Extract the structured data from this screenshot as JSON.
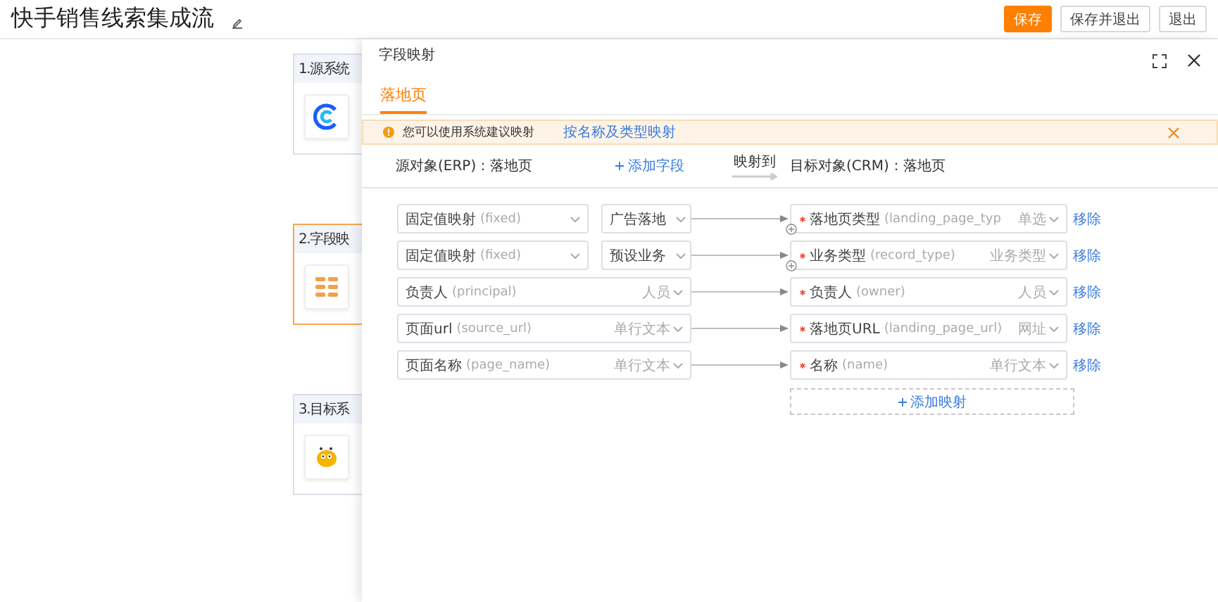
{
  "page_title": "快手销售线索集成流",
  "header_buttons": [
    {
      "label": "保存",
      "kind": "primary"
    },
    {
      "label": "保存并退出",
      "kind": "default"
    },
    {
      "label": "退出",
      "kind": "default"
    }
  ],
  "steps": [
    {
      "label": "1.源系统",
      "selected": false,
      "kind": "source"
    },
    {
      "label": "2.字段映",
      "selected": true,
      "kind": "mapping"
    },
    {
      "label": "3.目标系",
      "selected": false,
      "kind": "target"
    }
  ],
  "drawer": {
    "title": "字段映射",
    "tabs": [
      {
        "label": "落地页",
        "selected": true
      }
    ],
    "alert": {
      "text": "您可以使用系统建议映射",
      "link": "按名称及类型映射"
    },
    "source_label": "源对象(ERP)：落地页",
    "add_field": "添加字段",
    "map_to": "映射到",
    "target_label": "目标对象(CRM)：落地页",
    "mappings": [
      {
        "kind": "fixed",
        "source": {
          "name": "固定值映射",
          "api": "(fixed)"
        },
        "value": "广告落地",
        "target": {
          "name": "落地页类型",
          "api": "(landing_page_typ",
          "type": "单选",
          "required": true
        },
        "plus": true,
        "remove": "移除"
      },
      {
        "kind": "fixed",
        "source": {
          "name": "固定值映射",
          "api": "(fixed)"
        },
        "value": "预设业务",
        "target": {
          "name": "业务类型",
          "api": "(record_type)",
          "type": "业务类型",
          "required": true
        },
        "plus": true,
        "remove": "移除"
      },
      {
        "kind": "field",
        "source": {
          "name": "负责人",
          "api": "(principal)",
          "type": "人员"
        },
        "target": {
          "name": "负责人",
          "api": "(owner)",
          "type": "人员",
          "required": true
        },
        "plus": false,
        "remove": "移除"
      },
      {
        "kind": "field",
        "source": {
          "name": "页面url",
          "api": "(source_url)",
          "type": "单行文本"
        },
        "target": {
          "name": "落地页URL",
          "api": "(landing_page_url)",
          "type": "网址",
          "required": true
        },
        "plus": false,
        "remove": "移除"
      },
      {
        "kind": "field",
        "source": {
          "name": "页面名称",
          "api": "(page_name)",
          "type": "单行文本"
        },
        "target": {
          "name": "名称",
          "api": "(name)",
          "type": "单行文本",
          "required": true
        },
        "plus": false,
        "remove": "移除"
      }
    ],
    "add_mapping": "添加映射"
  }
}
